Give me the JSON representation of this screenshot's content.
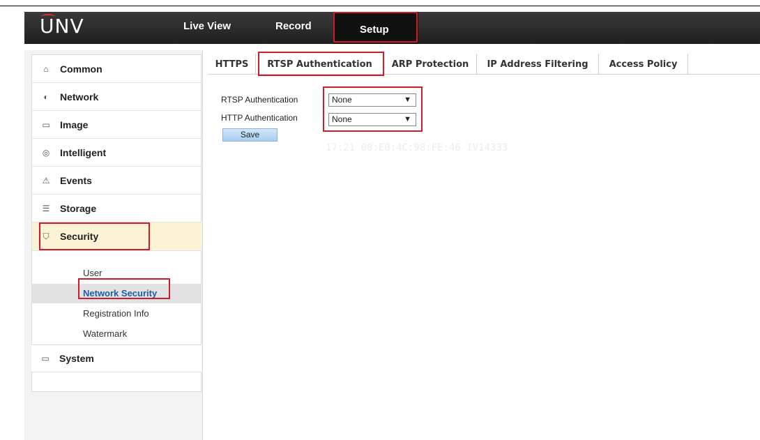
{
  "header": {
    "logo": "UNV",
    "nav": [
      {
        "label": "Live View"
      },
      {
        "label": "Record"
      },
      {
        "label": "Setup"
      }
    ]
  },
  "sidebar": {
    "items": [
      {
        "label": "Common",
        "icon": "home-icon"
      },
      {
        "label": "Network",
        "icon": "globe-icon"
      },
      {
        "label": "Image",
        "icon": "image-icon"
      },
      {
        "label": "Intelligent",
        "icon": "intelligent-icon"
      },
      {
        "label": "Events",
        "icon": "warning-icon"
      },
      {
        "label": "Storage",
        "icon": "storage-icon"
      },
      {
        "label": "Security",
        "icon": "shield-icon"
      },
      {
        "label": "System",
        "icon": "window-icon"
      }
    ],
    "security_sub": [
      {
        "label": "User"
      },
      {
        "label": "Network Security"
      },
      {
        "label": "Registration Info"
      },
      {
        "label": "Watermark"
      }
    ]
  },
  "tabs": [
    {
      "label": "HTTPS"
    },
    {
      "label": "RTSP Authentication"
    },
    {
      "label": "ARP Protection"
    },
    {
      "label": "IP Address Filtering"
    },
    {
      "label": "Access Policy"
    }
  ],
  "form": {
    "rtsp_label": "RTSP Authentication",
    "rtsp_value": "None",
    "http_label": "HTTP Authentication",
    "http_value": "None",
    "save_label": "Save"
  },
  "watermark_text": "17:21 00:E0:4C:98:FE:46 IV14333",
  "colors": {
    "highlight": "#d11a2a",
    "active_link": "#1a5ea8",
    "active_bg": "#fcf3d4"
  }
}
